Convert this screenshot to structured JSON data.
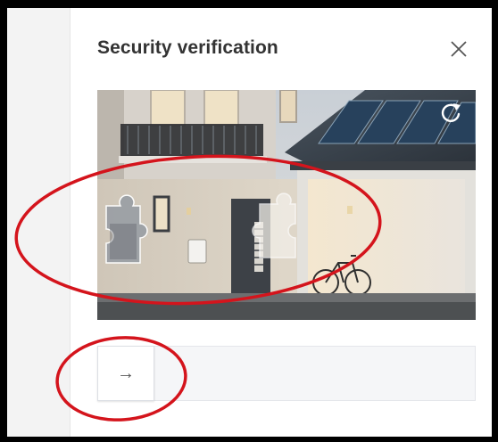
{
  "dialog": {
    "title": "Security verification",
    "close_icon": "close-icon"
  },
  "captcha": {
    "image": "house-scene-with-missing-puzzle-piece",
    "refresh_icon": "refresh-icon",
    "slider_icon": "arrow-right-icon",
    "slider_arrow": "→"
  },
  "annotations": {
    "color": "#d4141c"
  }
}
